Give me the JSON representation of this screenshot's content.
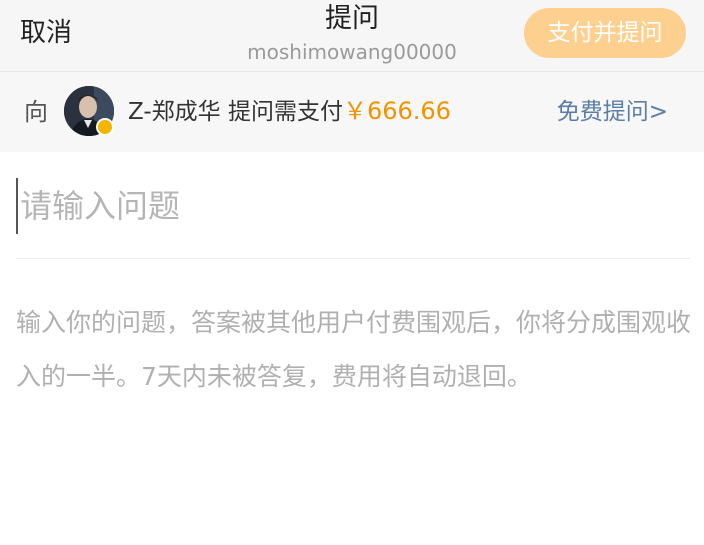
{
  "header": {
    "cancel_label": "取消",
    "title": "提问",
    "username": "moshimowang00000",
    "pay_button_label": "支付并提问"
  },
  "recipient": {
    "prefix": "向",
    "name": "Z-郑成华",
    "pay_text": "提问需支付",
    "price": "￥666.66",
    "free_link": "免费提问>"
  },
  "question": {
    "placeholder": "请输入问题",
    "value": ""
  },
  "hint": {
    "text": "输入你的问题，答案被其他用户付费围观后，你将分成围观收入的一半。7天内未被答复，费用将自动退回。"
  },
  "colors": {
    "accent": "#fdd090",
    "price": "#f09400",
    "link": "#5a7ea8"
  }
}
